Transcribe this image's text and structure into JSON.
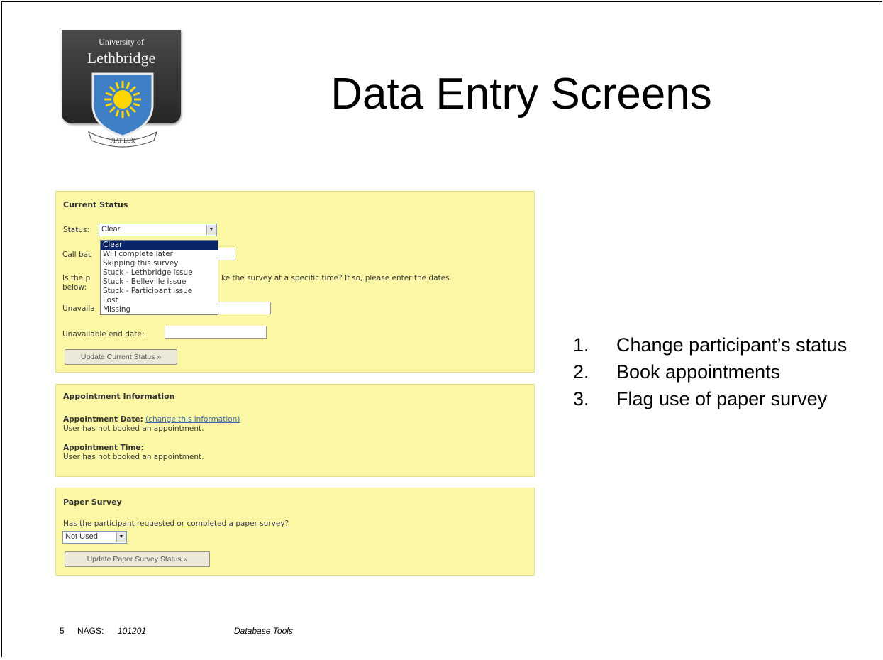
{
  "logo": {
    "line1": "University of",
    "line2": "Lethbridge",
    "motto": "FIAT LUX"
  },
  "slide": {
    "title": "Data Entry Screens"
  },
  "current_status": {
    "heading": "Current Status",
    "status_label": "Status:",
    "status_value": "Clear",
    "callback_label": "Call bac",
    "question_part1": "Is the p",
    "question_part2": "ke the survey at a specific time? If so, please enter the dates",
    "question_part3": "below:",
    "unavail_start_label": "Unavaila",
    "unavail_end_label": "Unavailable end date:",
    "update_button": "Update Current Status »",
    "dropdown_options": [
      "Clear",
      "Will complete later",
      "Skipping this survey",
      "Stuck - Lethbridge issue",
      "Stuck - Belleville issue",
      "Stuck - Participant issue",
      "Lost",
      "Missing"
    ]
  },
  "appointment": {
    "heading": "Appointment Information",
    "date_label": "Appointment Date:",
    "date_link": "(change this information)",
    "date_value": "User has not booked an appointment.",
    "time_label": "Appointment Time:",
    "time_value": "User has not booked an appointment."
  },
  "paper_survey": {
    "heading": "Paper Survey",
    "question": "Has the participant requested or completed a paper survey?",
    "select_value": "Not Used",
    "update_button": "Update Paper Survey Status »"
  },
  "steps": [
    {
      "num": "1.",
      "text": "Change participant’s status"
    },
    {
      "num": "2.",
      "text": "Book appointments"
    },
    {
      "num": "3.",
      "text": "Flag use of paper survey"
    }
  ],
  "footer": {
    "page": "5",
    "org": "NAGS:",
    "code": "101201",
    "section": "Database Tools"
  }
}
